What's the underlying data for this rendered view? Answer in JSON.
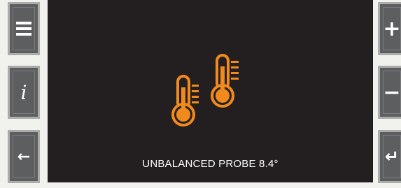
{
  "colors": {
    "screen_bg": "#231f20",
    "accent": "#f08a1c",
    "button_face": "#5d5e5f",
    "page_bg": "#f1f1ee"
  },
  "left_buttons": [
    {
      "name": "menu",
      "icon": "hamburger-icon"
    },
    {
      "name": "info",
      "icon": "info-icon",
      "glyph": "i"
    },
    {
      "name": "back",
      "icon": "arrow-left-icon",
      "glyph": "←"
    }
  ],
  "right_buttons": [
    {
      "name": "plus",
      "icon": "plus-icon",
      "glyph": "+"
    },
    {
      "name": "minus",
      "icon": "minus-icon",
      "glyph": "−"
    },
    {
      "name": "enter",
      "icon": "enter-icon",
      "glyph": "↵"
    }
  ],
  "display": {
    "icon": "thermometers-icon",
    "status_text": "UNBALANCED PROBE 8.4°"
  }
}
